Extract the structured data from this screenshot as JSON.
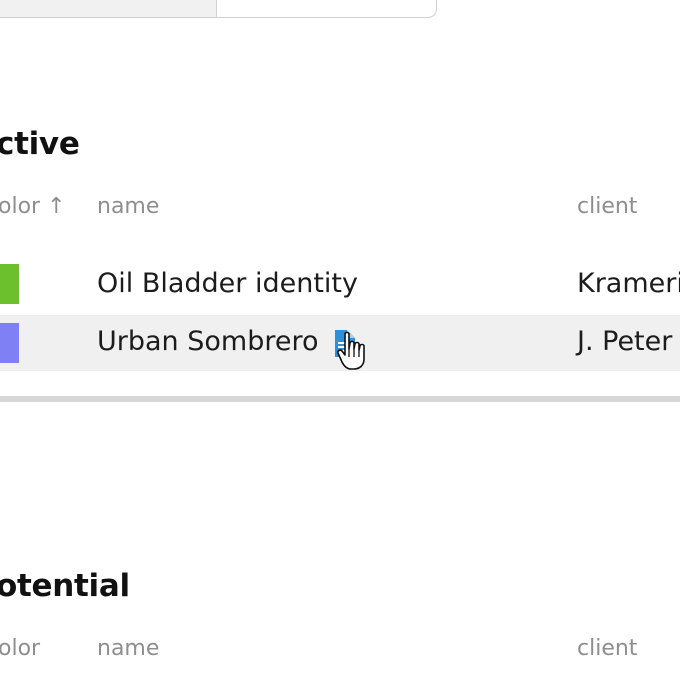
{
  "sections": {
    "active": {
      "title": "ctive",
      "columns": {
        "color": "olor ↑",
        "name": "name",
        "client": "client"
      },
      "rows": [
        {
          "color": "#6cc02e",
          "name": "Oil Bladder identity",
          "client": "Krameri"
        },
        {
          "color": "#8080f5",
          "name": "Urban Sombrero",
          "client": "J. Peter",
          "icon": "document-icon"
        }
      ]
    },
    "potential": {
      "title": "otential",
      "columns": {
        "color": "olor",
        "name": "name",
        "client": "client"
      }
    }
  },
  "colors": {
    "row_hover": "#f0f0f0",
    "divider": "#d7d7d7",
    "doc_icon": "#2f8fd8"
  }
}
